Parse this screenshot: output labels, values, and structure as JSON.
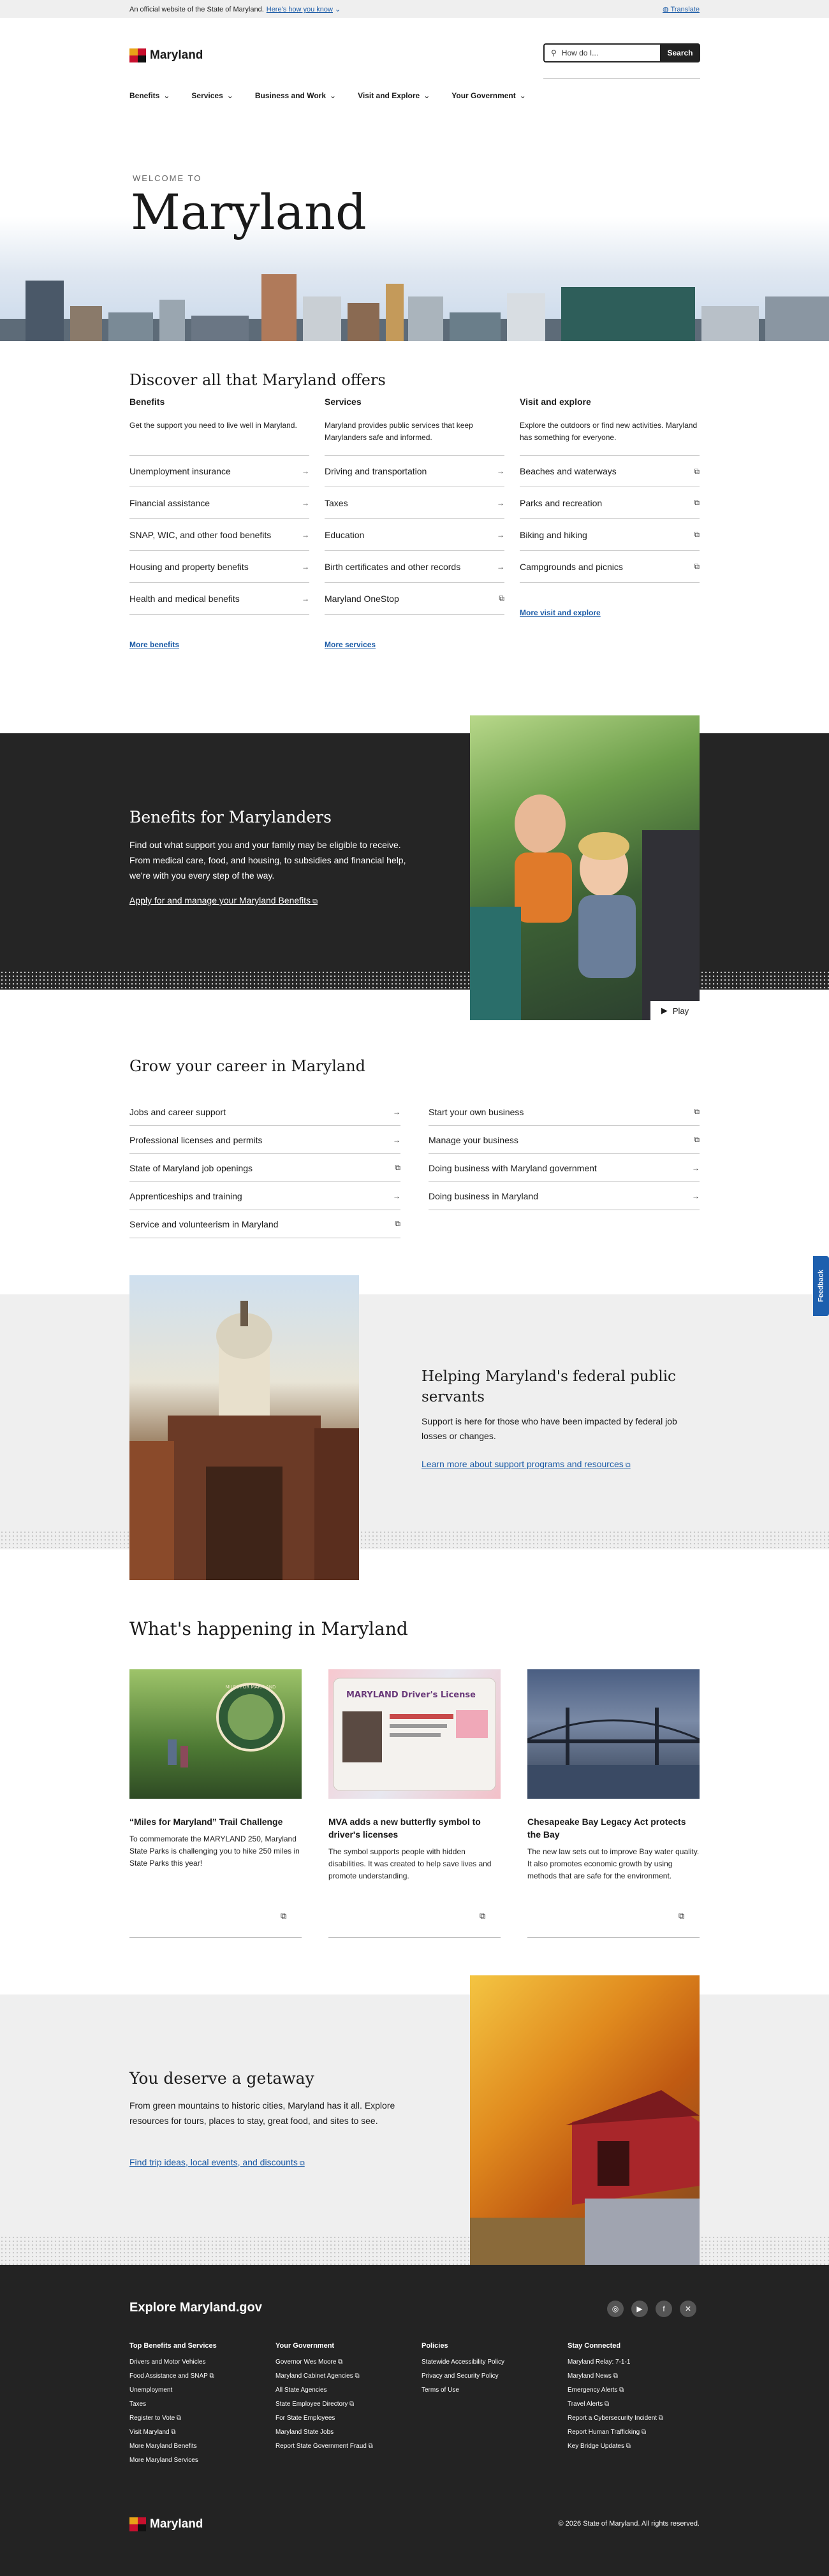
{
  "official": {
    "text": "An official website of the State of Maryland.",
    "how_link": "Here's how you know",
    "translate": "Translate"
  },
  "header": {
    "logo_text": "Maryland",
    "search_placeholder": "How do I...",
    "search_button": "Search",
    "nav": [
      "Benefits",
      "Services",
      "Business and Work",
      "Visit and Explore",
      "Your Government"
    ]
  },
  "hero": {
    "eyebrow": "WELCOME TO",
    "title": "Maryland"
  },
  "discover": {
    "title": "Discover all that Maryland offers",
    "columns": [
      {
        "heading": "Benefits",
        "desc": "Get the support you need to live well in Maryland.",
        "links": [
          {
            "label": "Unemployment insurance",
            "icon": "arrow-right-icon"
          },
          {
            "label": "Financial assistance",
            "icon": "arrow-right-icon"
          },
          {
            "label": "SNAP, WIC, and other food benefits",
            "icon": "arrow-right-icon"
          },
          {
            "label": "Housing and property benefits",
            "icon": "arrow-right-icon"
          },
          {
            "label": "Health and medical benefits",
            "icon": "arrow-right-icon"
          }
        ],
        "more": "More benefits"
      },
      {
        "heading": "Services",
        "desc": "Maryland provides public services that keep Marylanders safe and informed.",
        "links": [
          {
            "label": "Driving and transportation",
            "icon": "arrow-right-icon"
          },
          {
            "label": "Taxes",
            "icon": "arrow-right-icon"
          },
          {
            "label": "Education",
            "icon": "arrow-right-icon"
          },
          {
            "label": "Birth certificates and other records",
            "icon": "arrow-right-icon"
          },
          {
            "label": "Maryland OneStop",
            "icon": "external-link-icon"
          }
        ],
        "more": "More services"
      },
      {
        "heading": "Visit and explore",
        "desc": "Explore the outdoors or find new activities. Maryland has something for everyone.",
        "links": [
          {
            "label": "Beaches and waterways",
            "icon": "external-link-icon"
          },
          {
            "label": "Parks and recreation",
            "icon": "external-link-icon"
          },
          {
            "label": "Biking and hiking",
            "icon": "external-link-icon"
          },
          {
            "label": "Campgrounds and picnics",
            "icon": "external-link-icon"
          }
        ],
        "more": "More visit and explore"
      }
    ]
  },
  "benefits_band": {
    "title": "Benefits for Marylanders",
    "text": "Find out what support you and your family may be eligible to receive. From medical care, food, and housing, to subsidies and financial help, we're with you every step of the way.",
    "link": "Apply for and manage your Maryland Benefits",
    "play": "Play"
  },
  "career": {
    "title": "Grow your career in Maryland",
    "left": [
      {
        "label": "Jobs and career support",
        "icon": "arrow-right-icon"
      },
      {
        "label": "Professional licenses and permits",
        "icon": "arrow-right-icon"
      },
      {
        "label": "State of Maryland job openings",
        "icon": "external-link-icon"
      },
      {
        "label": "Apprenticeships and training",
        "icon": "arrow-right-icon"
      },
      {
        "label": "Service and volunteerism in Maryland",
        "icon": "external-link-icon"
      }
    ],
    "right": [
      {
        "label": "Start your own business",
        "icon": "external-link-icon"
      },
      {
        "label": "Manage your business",
        "icon": "external-link-icon"
      },
      {
        "label": "Doing business with Maryland government",
        "icon": "arrow-right-icon"
      },
      {
        "label": "Doing business in Maryland",
        "icon": "arrow-right-icon"
      }
    ]
  },
  "federal": {
    "title": "Helping Maryland's federal public servants",
    "text": "Support is here for those who have been impacted by federal job losses or changes.",
    "link": "Learn more about support programs and resources"
  },
  "happening": {
    "title": "What's happening in Maryland",
    "cards": [
      {
        "title": "“Miles for Maryland” Trail Challenge",
        "text": "To commemorate the MARYLAND 250, Maryland State Parks is challenging you to hike 250 miles in State Parks this year!",
        "badge_text": "MILES FOR MARYLAND"
      },
      {
        "title": "MVA adds a new butterfly symbol to driver's licenses",
        "text": "The symbol supports people with hidden disabilities. It was created to help save lives and promote understanding.",
        "badge_text": "MARYLAND Driver's License"
      },
      {
        "title": "Chesapeake Bay Legacy Act protects the Bay",
        "text": "The new law sets out to improve Bay water quality. It also promotes economic growth by using methods that are safe for the environment."
      }
    ]
  },
  "getaway": {
    "title": "You deserve a getaway",
    "text": "From green mountains to historic cities, Maryland has it all. Explore resources for tours, places to stay, great food, and sites to see.",
    "link": "Find trip ideas, local events, and discounts"
  },
  "footer": {
    "title": "Explore Maryland.gov",
    "social": [
      "instagram-icon",
      "youtube-icon",
      "facebook-icon",
      "x-icon"
    ],
    "columns": [
      {
        "heading": "Top Benefits and Services",
        "links": [
          "Drivers and Motor Vehicles",
          "Food Assistance and SNAP",
          "Unemployment",
          "Taxes",
          "Register to Vote",
          "Visit Maryland",
          "More Maryland Benefits",
          "More Maryland Services"
        ]
      },
      {
        "heading": "Your Government",
        "links": [
          "Governor Wes Moore",
          "Maryland Cabinet Agencies",
          "All State Agencies",
          "State Employee Directory",
          "For State Employees",
          "Maryland State Jobs",
          "Report State Government Fraud"
        ]
      },
      {
        "heading": "Policies",
        "links": [
          "Statewide Accessibility Policy",
          "Privacy and Security Policy",
          "Terms of Use"
        ]
      },
      {
        "heading": "Stay Connected",
        "links": [
          "Maryland Relay: 7-1-1",
          "Maryland News",
          "Emergency Alerts",
          "Travel Alerts",
          "Report a Cybersecurity Incident",
          "Report Human Trafficking",
          "Key Bridge Updates"
        ]
      }
    ],
    "logo_text": "Maryland",
    "copyright": "© 2026 State of Maryland. All rights reserved."
  },
  "feedback": "Feedback",
  "colors": {
    "link": "#1a5aa6",
    "dark": "#252525",
    "light_band": "#efefef",
    "feedback": "#1d5fae"
  }
}
